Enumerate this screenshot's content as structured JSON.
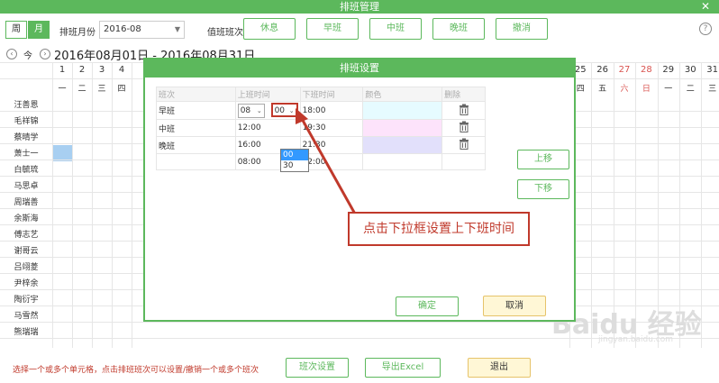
{
  "window": {
    "title": "排班管理",
    "close": "✕"
  },
  "toolbar": {
    "view_week": "周",
    "view_month": "月",
    "month_label": "排班月份",
    "month_value": "2016-08",
    "shift_label": "值班班次",
    "shift_buttons": [
      "休息",
      "早班",
      "中班",
      "晚班",
      "撤消"
    ],
    "help": "?"
  },
  "datebar": {
    "prev": "‹",
    "today": "今",
    "next": "›",
    "range": "2016年08月01日 - 2016年08月31日"
  },
  "calendar": {
    "days_left": [
      "1",
      "2",
      "3",
      "4"
    ],
    "weekdays_left": [
      "一",
      "二",
      "三",
      "四"
    ],
    "days_right": [
      "25",
      "26",
      "27",
      "28",
      "29",
      "30",
      "31"
    ],
    "weekdays_right": [
      "四",
      "五",
      "六",
      "日",
      "一",
      "二",
      "三"
    ],
    "weekend_color": "#d9534f",
    "employees": [
      "汪善恩",
      "毛祥锦",
      "蔡晴学",
      "萧士一",
      "白毓琉",
      "马思卓",
      "周瑞善",
      "余斯海",
      "傅志艺",
      "谢哥云",
      "吕翊菱",
      "尹梓余",
      "陶衍宇",
      "马雪然",
      "熊瑞瑞"
    ]
  },
  "dialog": {
    "title": "排班设置",
    "columns": [
      "班次",
      "上班时间",
      "下班时间",
      "颜色",
      "删除"
    ],
    "rows": [
      {
        "name": "早班",
        "start_h": "08",
        "start_m": "00",
        "end": "18:00",
        "color": "#e6fbff"
      },
      {
        "name": "中班",
        "start": "12:00",
        "end": "19:30",
        "color": "#fde3fb"
      },
      {
        "name": "晚班",
        "start": "16:00",
        "end": "21:30",
        "color": "#e2e0fb"
      },
      {
        "name": "",
        "start": "08:00",
        "end": "22:00",
        "color": ""
      }
    ],
    "dropdown_options": [
      "00",
      "30"
    ],
    "move_up": "上移",
    "move_down": "下移",
    "ok": "确定",
    "cancel": "取消"
  },
  "annotation": "点击下拉框设置上下班时间",
  "bottom": {
    "hint": "选择一个或多个单元格，点击排班班次可以设置/撤销一个或多个班次",
    "btn_shift_settings": "班次设置",
    "btn_export": "导出Excel",
    "btn_exit": "退出"
  },
  "watermark": {
    "main": "Baidu 经验",
    "sub": "jingyan.baidu.com"
  },
  "colors": {
    "accent": "#5cb85c",
    "annotation": "#c0392b",
    "selected_cell": "#a8cff1"
  }
}
